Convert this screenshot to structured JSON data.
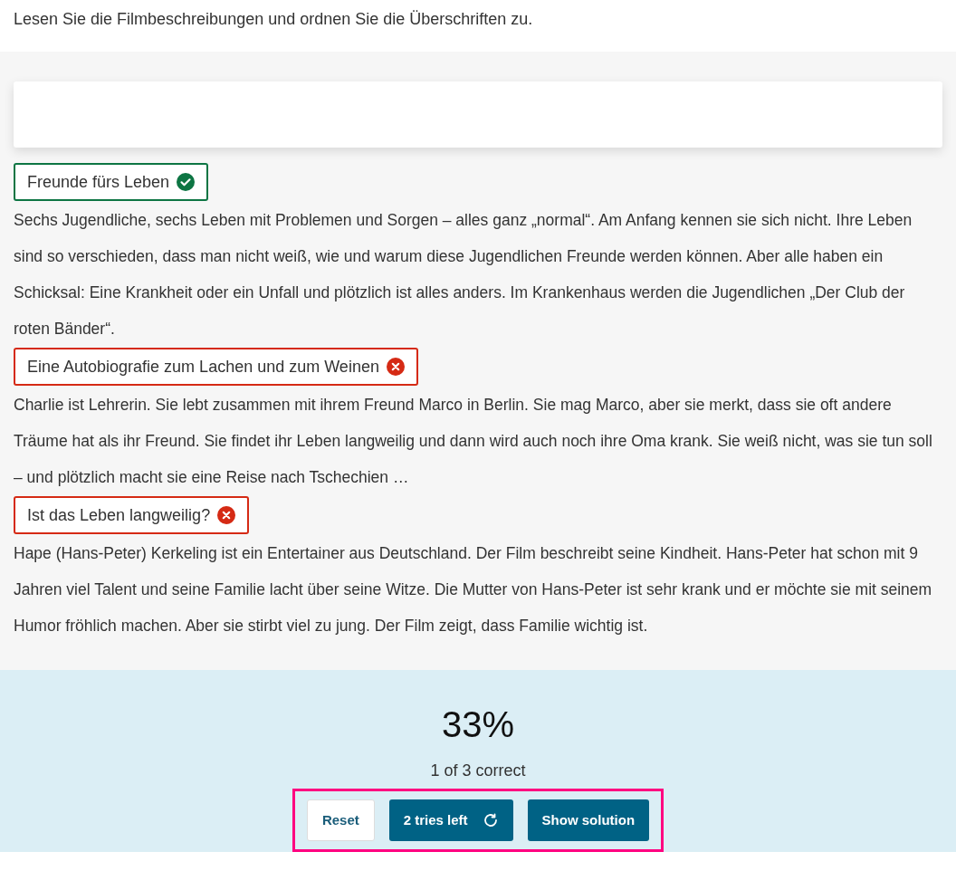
{
  "instruction": "Lesen Sie die Filmbeschreibungen und ordnen Sie die Überschriften zu.",
  "items": [
    {
      "heading": "Freunde fürs Leben",
      "correct": true,
      "text": "Sechs Jugendliche, sechs Leben mit Problemen und Sorgen – alles ganz „normal“. Am Anfang kennen sie sich nicht. Ihre Leben sind so verschieden, dass man nicht weiß, wie und warum diese Jugendlichen Freunde werden können. Aber alle haben ein Schicksal: Eine Krankheit oder ein Unfall und plötzlich ist alles anders. Im Krankenhaus werden die Jugendlichen „Der Club der roten Bänder“."
    },
    {
      "heading": "Eine Autobiografie zum Lachen und zum Weinen",
      "correct": false,
      "text": "Charlie ist Lehrerin. Sie lebt zusammen mit ihrem Freund Marco in Berlin. Sie mag Marco, aber sie merkt, dass sie oft andere Träume hat als ihr Freund. Sie findet ihr Leben langweilig und dann wird auch noch ihre Oma krank. Sie weiß nicht, was sie tun soll – und plötzlich macht sie eine Reise nach Tschechien …"
    },
    {
      "heading": "Ist das Leben langweilig?",
      "correct": false,
      "text": "Hape (Hans-Peter) Kerkeling ist ein Entertainer aus Deutschland. Der Film beschreibt seine Kindheit. Hans-Peter hat schon mit 9 Jahren viel Talent und seine Familie lacht über seine Witze. Die Mutter von Hans-Peter ist sehr krank und er möchte sie mit seinem Humor fröhlich machen. Aber sie stirbt viel zu jung. Der Film zeigt, dass Familie wichtig ist."
    }
  ],
  "score": "33%",
  "summary": "1 of 3 correct",
  "buttons": [
    {
      "label": "Reset",
      "kind": "secondary"
    },
    {
      "label": "2 tries left",
      "kind": "retry"
    },
    {
      "label": "Show solution",
      "kind": "primary"
    }
  ]
}
